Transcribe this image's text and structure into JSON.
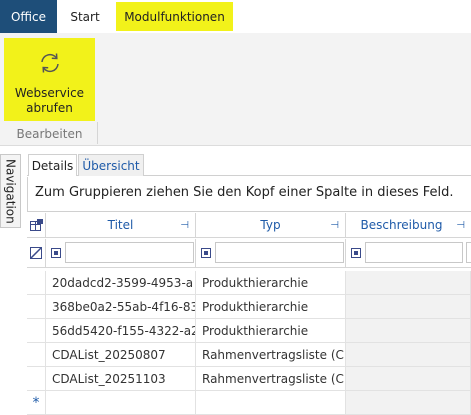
{
  "ribbon": {
    "tabs": [
      {
        "label": "Office"
      },
      {
        "label": "Start"
      },
      {
        "label": "Modulfunktionen"
      }
    ],
    "webservice_button": {
      "label_line1": "Webservice",
      "label_line2": "abrufen",
      "icon": "refresh-icon"
    },
    "group_label": "Bearbeiten",
    "colors": {
      "office_tab": "#1e4e79",
      "highlight": "#f2f21a",
      "link": "#1e5aa8"
    }
  },
  "navigation": {
    "label": "Navigation"
  },
  "view_tabs": [
    {
      "label": "Details"
    },
    {
      "label": "Übersicht"
    }
  ],
  "group_panel": {
    "hint": "Zum Gruppieren ziehen Sie den Kopf einer Spalte in dieses Feld."
  },
  "grid": {
    "columns": [
      {
        "label": "Titel"
      },
      {
        "label": "Typ"
      },
      {
        "label": "Beschreibung"
      }
    ],
    "rows": [
      {
        "titel": "20dadcd2-3599-4953-a",
        "typ": "Produkthierarchie",
        "beschreibung": ""
      },
      {
        "titel": "368be0a2-55ab-4f16-83",
        "typ": "Produkthierarchie",
        "beschreibung": ""
      },
      {
        "titel": "56dd5420-f155-4322-a2",
        "typ": "Produkthierarchie",
        "beschreibung": ""
      },
      {
        "titel": "CDAList_20250807",
        "typ": "Rahmenvertragsliste (C",
        "beschreibung": ""
      },
      {
        "titel": "CDAList_20251103",
        "typ": "Rahmenvertragsliste (C",
        "beschreibung": ""
      }
    ],
    "new_row_symbol": "*"
  }
}
